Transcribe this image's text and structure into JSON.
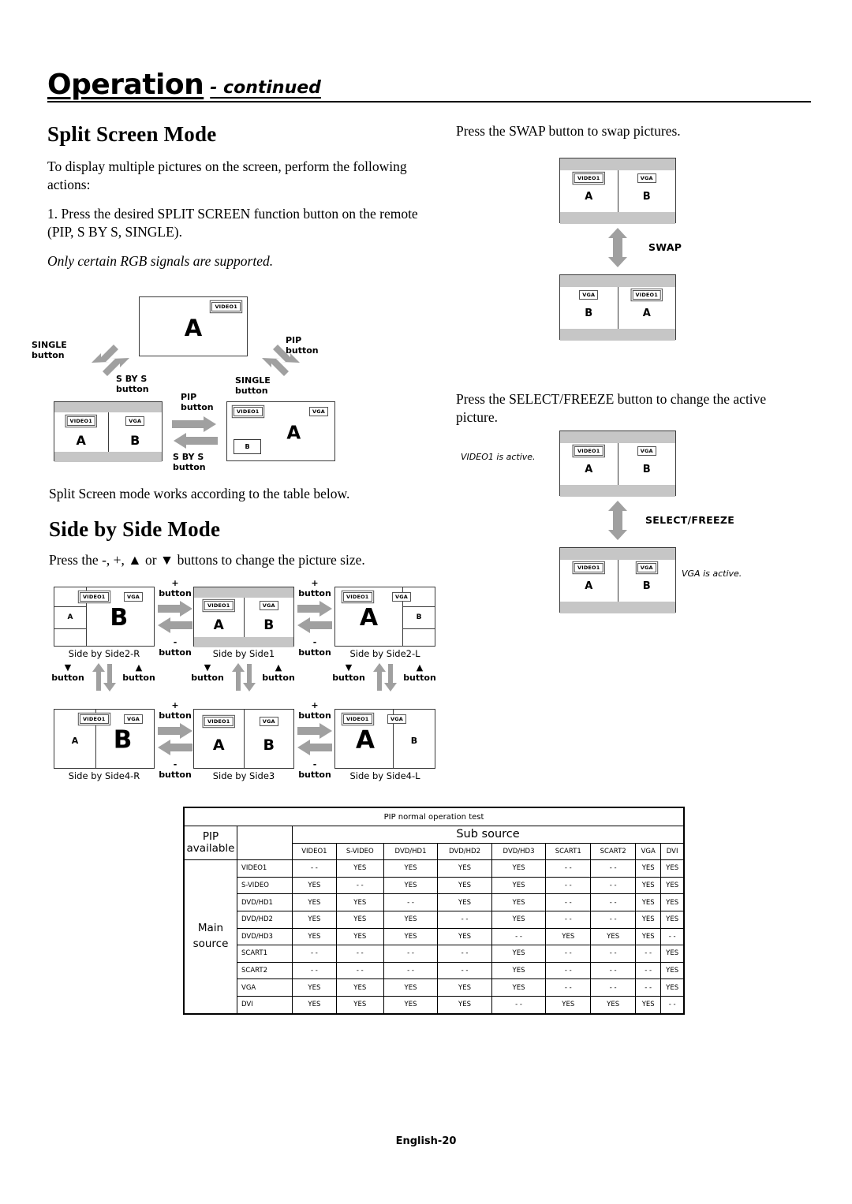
{
  "header": {
    "title": "Operation",
    "subtitle": "- continued"
  },
  "left_column": {
    "split_heading": "Split Screen Mode",
    "intro": "To display multiple pictures on the screen, perform the following actions:",
    "step1": "1. Press the desired SPLIT SCREEN function button on the remote (PIP, S BY S, SINGLE).",
    "note": "Only certain RGB signals are supported.",
    "table_intro": "Split Screen mode works according to the table below.",
    "sbs_heading": "Side by Side Mode",
    "sbs_intro": "Press the -, +, ▲ or ▼ buttons to change the picture size."
  },
  "right_column": {
    "swap_text": "Press the SWAP button to swap pictures.",
    "swap_label": "SWAP",
    "select_text": "Press the SELECT/FREEZE button to change the active picture.",
    "select_label": "SELECT/FREEZE",
    "video1_active": "VIDEO1 is active.",
    "vga_active": "VGA is active."
  },
  "split_diagram": {
    "single_screen": {
      "tag": "VIDEO1",
      "letter": "A"
    },
    "sbys_screen": {
      "tag_left": "VIDEO1",
      "tag_right": "VGA",
      "letter_left": "A",
      "letter_right": "B"
    },
    "pip_screen": {
      "tag_left": "VIDEO1",
      "tag_right": "VGA",
      "letter_main": "A",
      "letter_inset": "B"
    },
    "labels": {
      "single_btn": "SINGLE\nbutton",
      "single_btn_l1": "SINGLE",
      "single_btn_l2": "button",
      "sbys_btn_l1": "S BY S",
      "sbys_btn_l2": "button",
      "pip_btn_l1": "PIP",
      "pip_btn_l2": "button",
      "single2_l1": "SINGLE",
      "single2_l2": "button",
      "pip2_l1": "PIP",
      "pip2_l2": "button",
      "sbys2_l1": "S BY S",
      "sbys2_l2": "button"
    }
  },
  "sbs_diagram": {
    "tag_video1": "VIDEO1",
    "tag_vga": "VGA",
    "letter_a": "A",
    "letter_b": "B",
    "plus_l1": "+",
    "plus_l2": "button",
    "minus_l1": "-",
    "minus_l2": "button",
    "down_l1": "▼",
    "down_l2": "button",
    "up_l1": "▲",
    "up_l2": "button",
    "captions": {
      "side2r": "Side by Side2-R",
      "side1": "Side by Side1",
      "side2l": "Side by Side2-L",
      "side4r": "Side by Side4-R",
      "side3": "Side by Side3",
      "side4l": "Side by Side4-L"
    }
  },
  "pip_table": {
    "title": "PIP normal operation test",
    "corner_l1": "PIP",
    "corner_l2": "available",
    "sub_source": "Sub source",
    "main_source_l1": "Main",
    "main_source_l2": "source",
    "columns": [
      "VIDEO1",
      "S-VIDEO",
      "DVD/HD1",
      "DVD/HD2",
      "DVD/HD3",
      "SCART1",
      "SCART2",
      "VGA",
      "DVI"
    ],
    "rows": [
      {
        "label": "VIDEO1",
        "values": [
          "- -",
          "YES",
          "YES",
          "YES",
          "YES",
          "- -",
          "- -",
          "YES",
          "YES"
        ]
      },
      {
        "label": "S-VIDEO",
        "values": [
          "YES",
          "- -",
          "YES",
          "YES",
          "YES",
          "- -",
          "- -",
          "YES",
          "YES"
        ]
      },
      {
        "label": "DVD/HD1",
        "values": [
          "YES",
          "YES",
          "- -",
          "YES",
          "YES",
          "- -",
          "- -",
          "YES",
          "YES"
        ]
      },
      {
        "label": "DVD/HD2",
        "values": [
          "YES",
          "YES",
          "YES",
          "- -",
          "YES",
          "- -",
          "- -",
          "YES",
          "YES"
        ]
      },
      {
        "label": "DVD/HD3",
        "values": [
          "YES",
          "YES",
          "YES",
          "YES",
          "- -",
          "YES",
          "YES",
          "YES",
          "- -"
        ]
      },
      {
        "label": "SCART1",
        "values": [
          "- -",
          "- -",
          "- -",
          "- -",
          "YES",
          "- -",
          "- -",
          "- -",
          "YES"
        ]
      },
      {
        "label": "SCART2",
        "values": [
          "- -",
          "- -",
          "- -",
          "- -",
          "YES",
          "- -",
          "- -",
          "- -",
          "YES"
        ]
      },
      {
        "label": "VGA",
        "values": [
          "YES",
          "YES",
          "YES",
          "YES",
          "YES",
          "- -",
          "- -",
          "- -",
          "YES"
        ]
      },
      {
        "label": "DVI",
        "values": [
          "YES",
          "YES",
          "YES",
          "YES",
          "- -",
          "YES",
          "YES",
          "YES",
          "- -"
        ]
      }
    ]
  },
  "footer": {
    "page": "English-20"
  },
  "colors": {
    "gray_bar": "#c6c6c6",
    "arrow_gray": "#a0a0a0",
    "border": "#3a3a3a"
  }
}
